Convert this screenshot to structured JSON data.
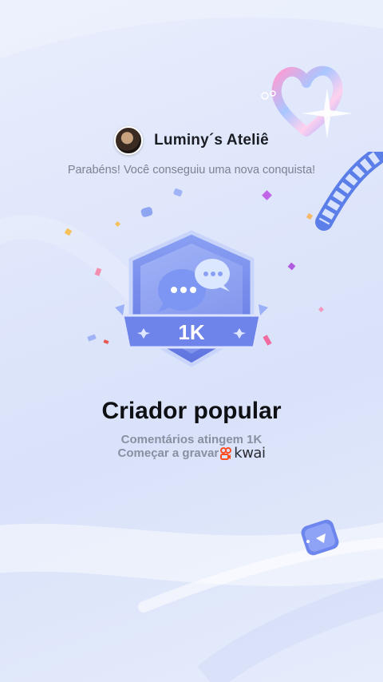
{
  "profile": {
    "avatar_icon": "user-avatar",
    "username": "Luminy´s Ateliê"
  },
  "congrats_text": "Parabéns! Você conseguiu uma nova conquista!",
  "badge": {
    "icon": "chat-bubbles-icon",
    "value": "1K"
  },
  "achievement": {
    "title": "Criador popular",
    "description": "Comentários atingem 1K",
    "cta_text": "Começar a gravar",
    "brand": "kwai"
  },
  "colors": {
    "accent": "#6a7ee8",
    "brand": "#ff4d1f"
  }
}
